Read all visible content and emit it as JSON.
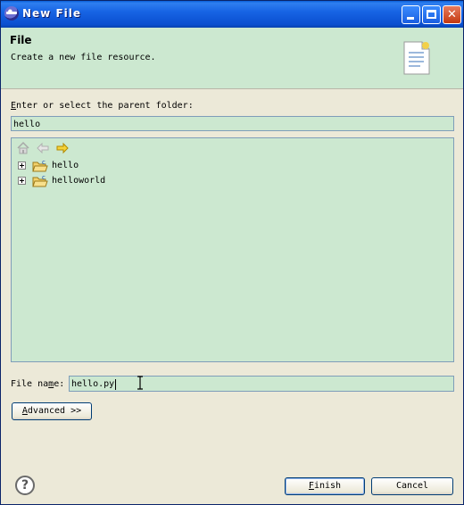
{
  "window": {
    "title": "New File"
  },
  "header": {
    "title": "File",
    "description": "Create a new file resource."
  },
  "parent_folder": {
    "label_mnemonic": "E",
    "label_rest": "nter or select the parent folder:",
    "value": "hello"
  },
  "tree": {
    "items": [
      {
        "label": "hello"
      },
      {
        "label": "helloworld"
      }
    ]
  },
  "file_name": {
    "label_before": "File na",
    "label_mnemonic": "m",
    "label_after": "e:",
    "value": "hello.py"
  },
  "buttons": {
    "advanced_mnemonic": "A",
    "advanced_rest": "dvanced >>",
    "finish_mnemonic": "F",
    "finish_rest": "inish",
    "cancel": "Cancel",
    "help": "?"
  }
}
